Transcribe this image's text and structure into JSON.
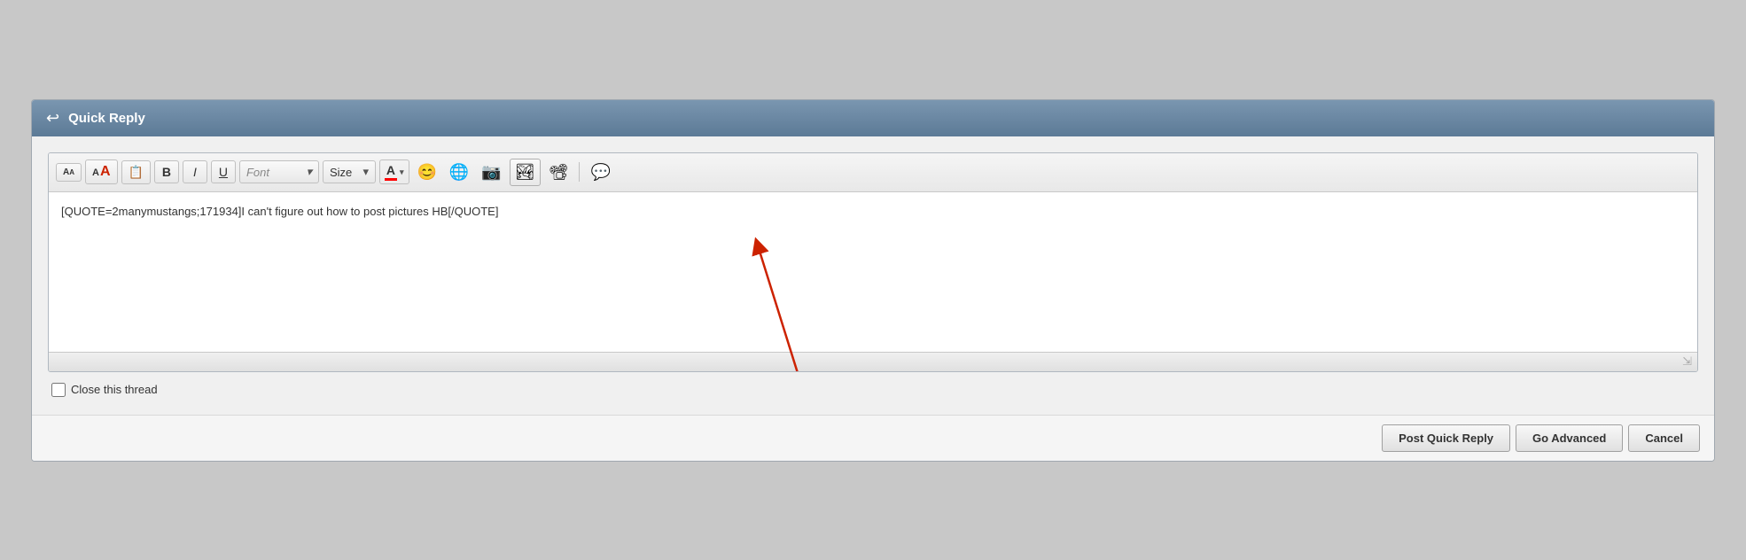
{
  "panel": {
    "title": "Quick Reply",
    "back_icon": "↩"
  },
  "toolbar": {
    "font_label": "Font",
    "size_label": "Size",
    "bold_label": "B",
    "italic_label": "I",
    "underline_label": "U",
    "font_size_smaller": "A",
    "font_size_larger": "A",
    "dropdown_arrow": "▾",
    "text_color_label": "A",
    "emoji_icon": "😊",
    "globe_icon": "🌐",
    "camera_icon": "📷",
    "image_icon": "🖼",
    "film_icon": "🎬",
    "comment_icon": "💬"
  },
  "editor": {
    "content": "[QUOTE=2manymustangs;171934]I can't figure out how to post pictures HB[/QUOTE]",
    "resize_handle": "⇲"
  },
  "footer": {
    "close_thread_label": "Close this thread"
  },
  "buttons": {
    "post_quick_reply": "Post Quick Reply",
    "go_advanced": "Go Advanced",
    "cancel": "Cancel"
  }
}
